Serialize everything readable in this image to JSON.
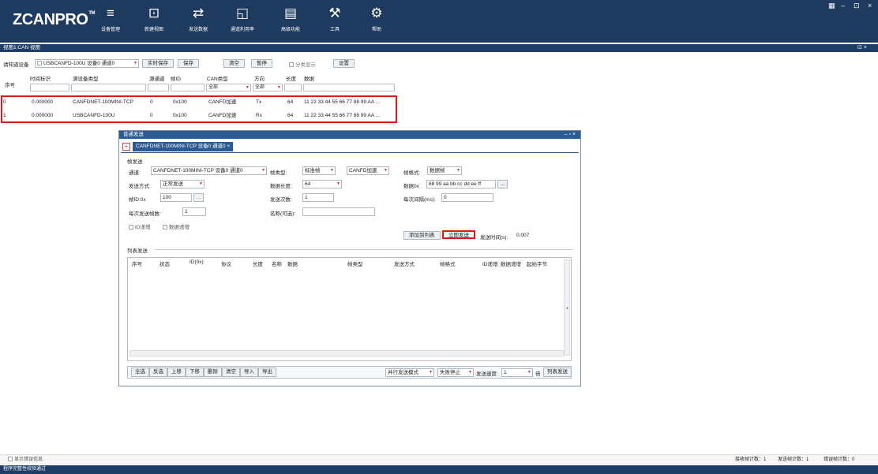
{
  "app": {
    "logo": "ZCANPRO",
    "tm": "TM"
  },
  "toolbar": [
    {
      "label": "设备管理",
      "icon": "≡"
    },
    {
      "label": "新建视图",
      "icon": "⊡"
    },
    {
      "label": "发送数据",
      "icon": "⇄"
    },
    {
      "label": "通道利用率",
      "icon": "◱"
    },
    {
      "label": "高级功能",
      "icon": "▤"
    },
    {
      "label": "工具",
      "icon": "⚒"
    },
    {
      "label": "帮助",
      "icon": "⚙"
    }
  ],
  "window_controls": {
    "grid": "▦",
    "min": "–",
    "restore": "⊡",
    "close": "×"
  },
  "view": {
    "title": "视图1:CAN 视图",
    "controls": "⊡ ×"
  },
  "toprow": {
    "device_label": "请知道设备",
    "device_value": "USBCANFD-100U 设备0 通道0",
    "realtime_save": "实时保存",
    "save": "保存",
    "clear": "清空",
    "pause": "暂停",
    "category_label": "分类显示",
    "settings": "设置"
  },
  "columns": {
    "index": "序号",
    "time": "时间标识",
    "src_type": "源设备类型",
    "src_ch": "源通道",
    "frame_id": "帧ID",
    "can_type": "CAN类型",
    "can_type_filter": "全部",
    "dir": "方向",
    "dir_filter": "全部",
    "len": "长度",
    "data": "数据"
  },
  "rows": [
    {
      "index": "0",
      "time": "0.000000",
      "src": "CANFDNET-100MINI-TCP",
      "ch": "0",
      "id": "0x100",
      "type": "CANFD加速",
      "dir": "Tx",
      "len": "64",
      "data": "11 22 33 44 55 66 77 88 99 AA ..."
    },
    {
      "index": "1",
      "time": "0.000000",
      "src": "USBCANFD-100U",
      "ch": "0",
      "id": "0x100",
      "type": "CANFD加速",
      "dir": "Rx",
      "len": "64",
      "data": "11 22 33 44 55 66 77 88 99 AA ..."
    }
  ],
  "dialog": {
    "title": "普通发送",
    "controls": "– ▫ ×",
    "tab": "CANFDNET-100MINI-TCP 设备0 通道0",
    "frame_send": "帧发送",
    "channel_label": "通道:",
    "channel_value": "CANFDNET-100MINI-TCP 设备0 通道0",
    "frame_type_label": "帧类型:",
    "frame_type_value": "标准帧",
    "protocol_value": "CANFD加速",
    "frame_format_label": "帧格式:",
    "frame_format_value": "数据帧",
    "send_mode_label": "发送方式:",
    "send_mode_value": "正常发送",
    "data_len_label": "数据长度:",
    "data_len_value": "64",
    "data_label": "数据0x",
    "data_value": "88 99 aa bb cc dd ee ff",
    "frame_id_label": "帧ID:0x",
    "frame_id_value": "100",
    "send_count_label": "发送次数:",
    "send_count_value": "1",
    "interval_label": "每次间隔(ms):",
    "interval_value": "0",
    "frames_per_send_label": "每次发送帧数:",
    "frames_per_send_value": "1",
    "name_label": "名称(可选):",
    "name_value": "",
    "id_inc": "ID递增",
    "data_inc": "数据递增",
    "add_to_list": "添加到列表",
    "send_now": "立即发送",
    "send_time_label": "发送时间(s):",
    "send_time_value": "0.007",
    "list_send": "列表发送",
    "list_cols": [
      "序号",
      "状态",
      "ID(0x)",
      "协议",
      "长度",
      "名称",
      "数据",
      "帧类型",
      "发送方式",
      "帧格式",
      "ID递增",
      "数据递增",
      "起始字节"
    ],
    "buttons": [
      "全选",
      "反选",
      "上移",
      "下移",
      "删除",
      "清空",
      "导入",
      "导出"
    ],
    "parallel": "并行发送模式",
    "fail_stop": "失败停止",
    "speed_label": "发送速度:",
    "speed_value": "1",
    "times": "倍",
    "list_send_btn": "列表发送"
  },
  "statusbar": {
    "show_error": "显示错误信息",
    "rx": "接收帧计数：1",
    "tx": "发送帧计数：1",
    "err": "错误帧计数：0"
  },
  "bottom": "程序完整性校验通过"
}
